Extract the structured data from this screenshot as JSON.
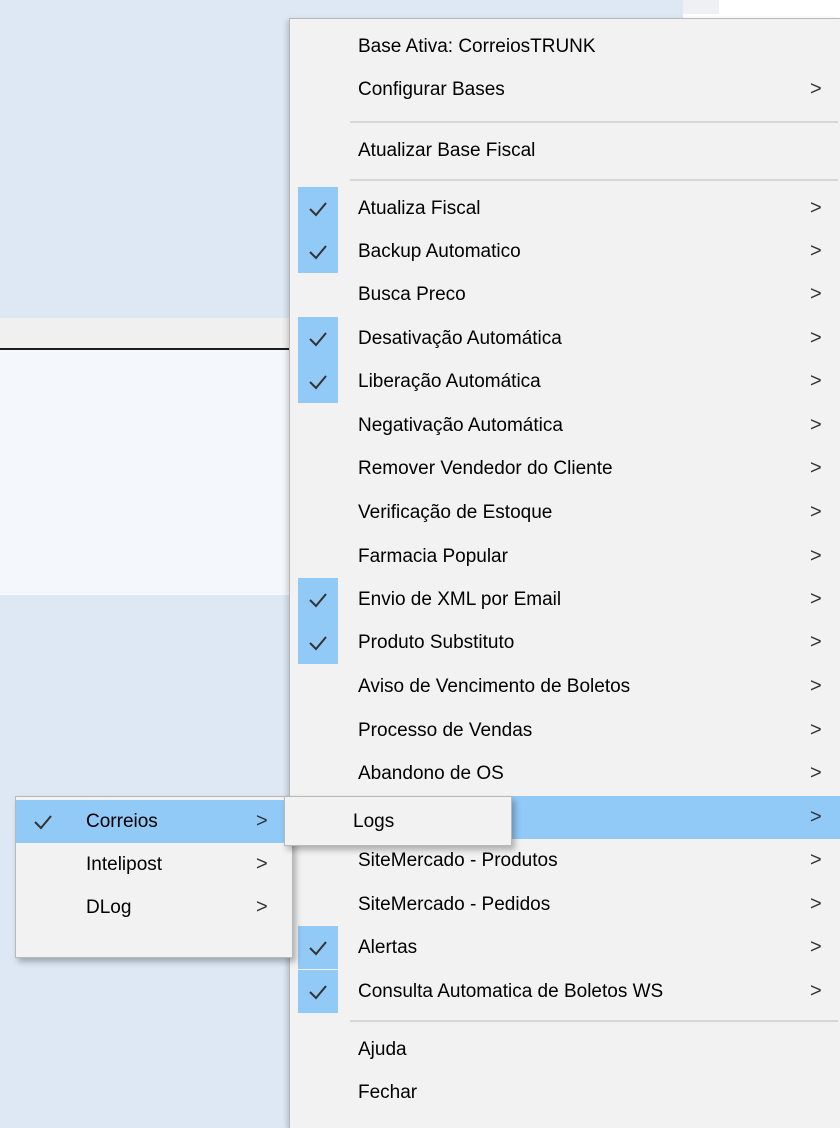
{
  "menu": {
    "items": [
      {
        "label": "Base Ativa: CorreiosTRUNK",
        "checked": false,
        "submenu": false
      },
      {
        "label": "Configurar Bases",
        "checked": false,
        "submenu": true
      },
      {
        "label": "Atualizar Base Fiscal",
        "checked": false,
        "submenu": false
      },
      {
        "label": "Atualiza Fiscal",
        "checked": true,
        "submenu": true
      },
      {
        "label": "Backup Automatico",
        "checked": true,
        "submenu": true
      },
      {
        "label": "Busca Preco",
        "checked": false,
        "submenu": true
      },
      {
        "label": "Desativação Automática",
        "checked": true,
        "submenu": true
      },
      {
        "label": "Liberação Automática",
        "checked": true,
        "submenu": true
      },
      {
        "label": "Negativação Automática",
        "checked": false,
        "submenu": true
      },
      {
        "label": "Remover Vendedor do Cliente",
        "checked": false,
        "submenu": true
      },
      {
        "label": "Verificação de Estoque",
        "checked": false,
        "submenu": true
      },
      {
        "label": "Farmacia Popular",
        "checked": false,
        "submenu": true
      },
      {
        "label": "Envio de XML por Email",
        "checked": true,
        "submenu": true
      },
      {
        "label": "Produto Substituto",
        "checked": true,
        "submenu": true
      },
      {
        "label": "Aviso de Vencimento de Boletos",
        "checked": false,
        "submenu": true
      },
      {
        "label": "Processo de Vendas",
        "checked": false,
        "submenu": true
      },
      {
        "label": "Abandono de OS",
        "checked": false,
        "submenu": true
      },
      {
        "label": "",
        "checked": false,
        "submenu": true,
        "highlighted": true
      },
      {
        "label": "SiteMercado - Produtos",
        "checked": false,
        "submenu": true
      },
      {
        "label": "SiteMercado - Pedidos",
        "checked": false,
        "submenu": true
      },
      {
        "label": "Alertas",
        "checked": true,
        "submenu": true
      },
      {
        "label": "Consulta Automatica de Boletos WS",
        "checked": true,
        "submenu": true
      },
      {
        "label": "Ajuda",
        "checked": false,
        "submenu": false
      },
      {
        "label": "Fechar",
        "checked": false,
        "submenu": false
      }
    ],
    "arrow_glyph": ">"
  },
  "submenu1": {
    "items": [
      {
        "label": "Correios",
        "checked": true,
        "highlighted": true
      },
      {
        "label": "Intelipost",
        "checked": false
      },
      {
        "label": "DLog",
        "checked": false
      }
    ]
  },
  "submenu2": {
    "items": [
      {
        "label": "Logs"
      }
    ]
  },
  "colors": {
    "highlight": "#91c9f7",
    "menu_background": "#f2f2f2",
    "window_background": "#dde8f4"
  }
}
